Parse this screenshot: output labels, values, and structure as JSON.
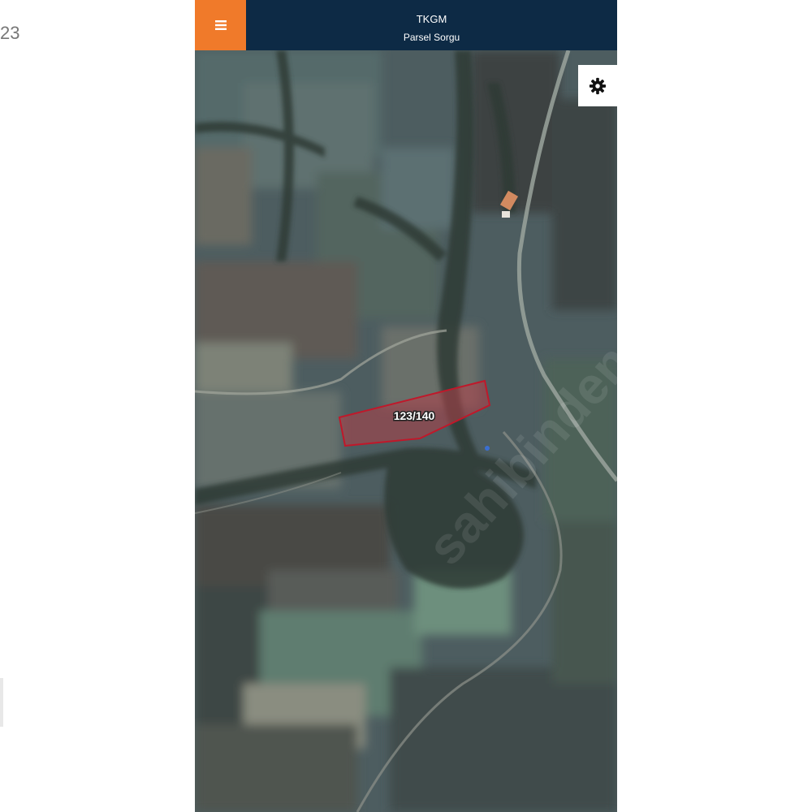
{
  "page_edge": {
    "stray_text": "23"
  },
  "header": {
    "title": "TKGM",
    "subtitle": "Parsel Sorgu"
  },
  "map": {
    "parcel_label": "123/140",
    "watermark": "sahibinden.com"
  },
  "colors": {
    "header_bg": "#0d2a45",
    "menu_button_bg": "#f07a2a",
    "parcel_outline": "#c0182a",
    "parcel_fill": "#b04048"
  },
  "icons": {
    "menu": "hamburger-menu-icon",
    "settings": "gear-icon"
  }
}
